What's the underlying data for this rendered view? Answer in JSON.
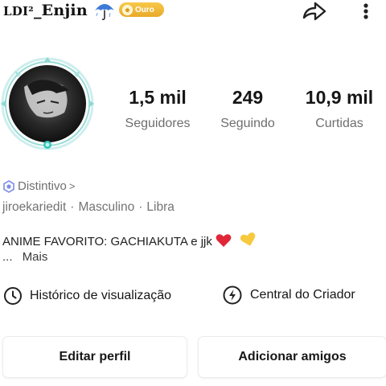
{
  "header": {
    "username_prefix": "LDI²",
    "username_name": "_Enjin",
    "badge_label": "Ouro"
  },
  "stats": [
    {
      "value": "1,5 mil",
      "label": "Seguidores"
    },
    {
      "value": "249",
      "label": "Seguindo"
    },
    {
      "value": "10,9 mil",
      "label": "Curtidas"
    }
  ],
  "profile": {
    "distintivo_label": "Distintivo",
    "distintivo_chevron": ">",
    "meta": [
      "jiroekariedit",
      "Masculino",
      "Libra"
    ],
    "meta_separator": "·",
    "bio_text": "ANIME FAVORITO: GACHIAKUTA  e jjk",
    "bio_emojis": [
      "red-heart",
      "yellow-heart"
    ],
    "more_prefix": "...",
    "more_label": "Mais"
  },
  "links": {
    "history_label": "Histórico de visualização",
    "creator_label": "Central do Criador"
  },
  "buttons": {
    "edit_label": "Editar perfil",
    "add_label": "Adicionar amigos"
  },
  "colors": {
    "badge_gold": "#f0b83a",
    "frame_teal": "#7fd8d2",
    "heart_red": "#e0273a",
    "heart_yellow": "#f6c93f",
    "distintivo_blue": "#7b8ee6"
  },
  "icons": {
    "umbrella": "umbrella-icon",
    "share": "share-icon",
    "more": "more-vertical-icon",
    "history": "clock-icon",
    "creator": "lightning-circle-icon"
  }
}
